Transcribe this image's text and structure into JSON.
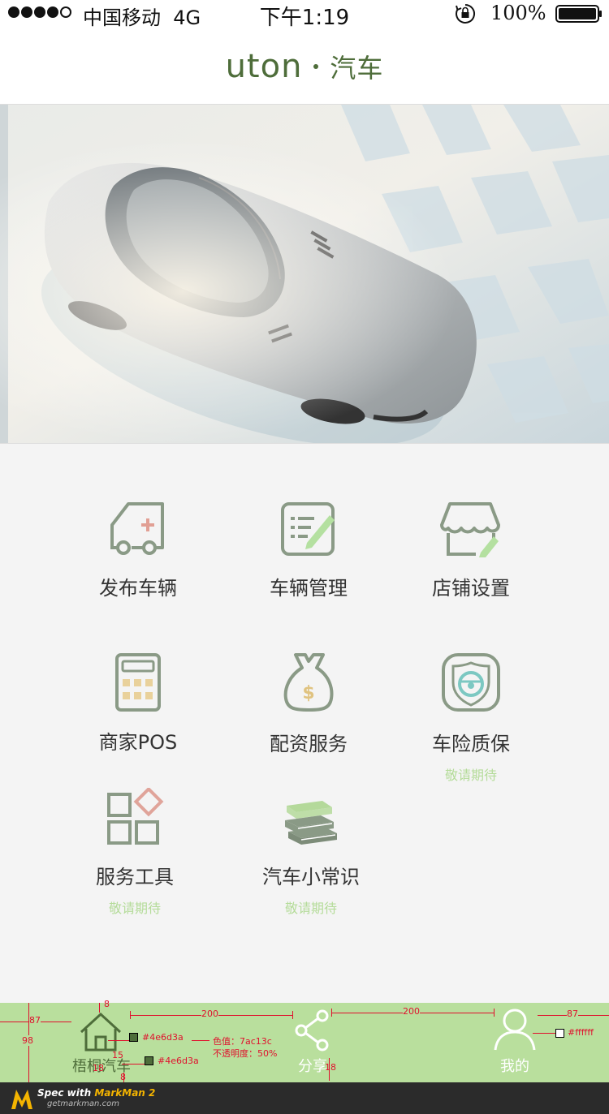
{
  "status_bar": {
    "carrier": "中国移动",
    "network": "4G",
    "time": "下午1:19",
    "battery": "100%"
  },
  "header": {
    "brand_latin": "uton",
    "brand_cn": "汽车"
  },
  "banner": {
    "image": "silver sports car top view"
  },
  "menu": [
    {
      "label": "发布车辆",
      "icon": "publish-vehicle-icon",
      "note": ""
    },
    {
      "label": "车辆管理",
      "icon": "vehicle-management-icon",
      "note": ""
    },
    {
      "label": "店铺设置",
      "icon": "store-settings-icon",
      "note": ""
    },
    {
      "label": "商家POS",
      "icon": "calculator-icon",
      "note": ""
    },
    {
      "label": "配资服务",
      "icon": "money-bag-icon",
      "note": ""
    },
    {
      "label": "车险质保",
      "icon": "steering-shield-icon",
      "note": "敬请期待"
    },
    {
      "label": "服务工具",
      "icon": "tools-grid-icon",
      "note": "敬请期待"
    },
    {
      "label": "汽车小常识",
      "icon": "books-icon",
      "note": "敬请期待"
    }
  ],
  "tabbar": {
    "tabs": [
      {
        "label": "梧桐汽车",
        "icon": "home-icon",
        "active": true
      },
      {
        "label": "分享",
        "icon": "share-icon",
        "active": false
      },
      {
        "label": "我的",
        "icon": "user-icon",
        "active": false
      }
    ]
  },
  "spec_annotations": {
    "gap_left": "87",
    "gap_right": "87",
    "gap_mid1": "200",
    "gap_mid2": "200",
    "bar_height": "98",
    "icon_top": "8",
    "icon_to_text": "15",
    "label_size_home": "18",
    "label_size_share": "18",
    "label_bottom": "8",
    "color_icon": "#4e6d3a",
    "color_label": "#4e6d3a",
    "color_note_line1": "色值：7ac13c",
    "color_note_line2": "不透明度：50%",
    "color_white": "#ffffff"
  },
  "colors": {
    "accent": "#4e6d3a",
    "icon_gray": "#8a9a86",
    "tabbar_bg": "#b9df9d",
    "note_green": "#b5dc9a",
    "publish_plus": "#e19f94",
    "manage_pen": "#b4e0a0",
    "pos_keys": "#e9d19b",
    "bag_dollar": "#e0c380",
    "diamond": "#e0a49a",
    "books_top": "#b4d99a"
  },
  "footer": {
    "brand_a": "Spec with",
    "brand_b": "MarkMan 2",
    "url": "getmarkman.com"
  }
}
